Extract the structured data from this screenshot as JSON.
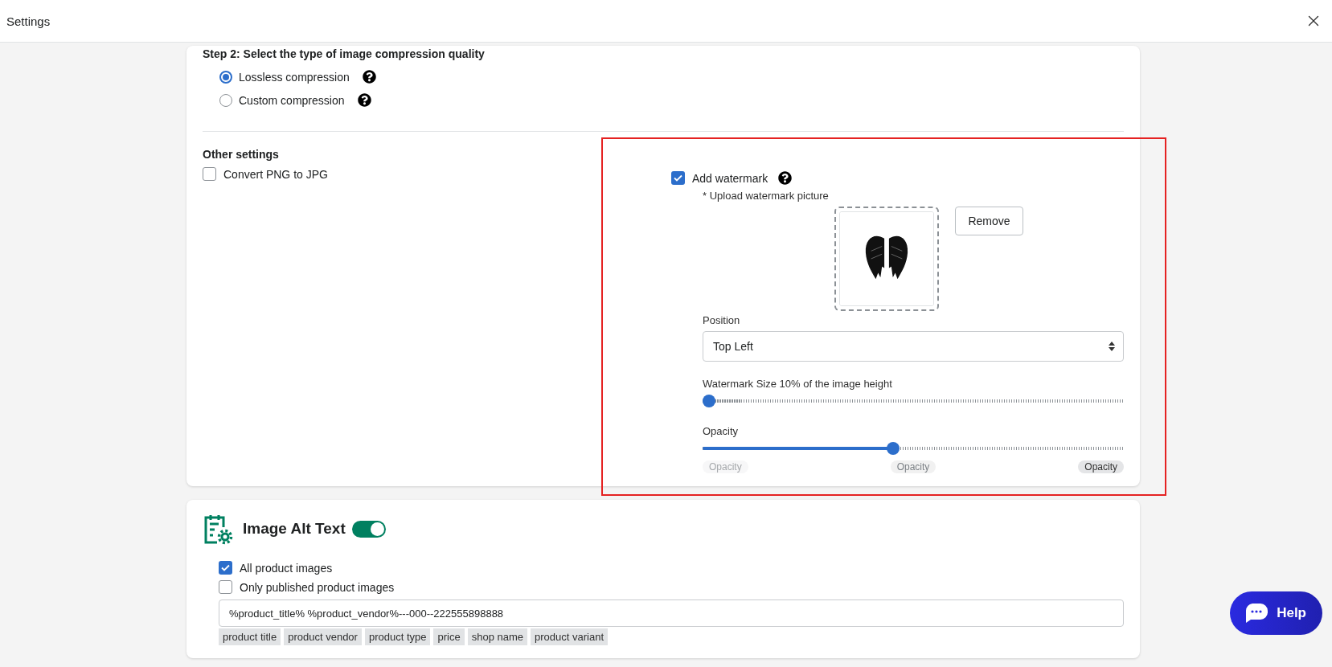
{
  "window": {
    "title": "Settings"
  },
  "compression": {
    "heading": "Step 2: Select the type of image compression quality",
    "options": [
      {
        "label": "Lossless compression",
        "selected": true
      },
      {
        "label": "Custom compression",
        "selected": false
      }
    ]
  },
  "other_settings": {
    "heading": "Other settings",
    "convert_png": {
      "label": "Convert PNG to JPG",
      "checked": false
    },
    "watermark": {
      "label": "Add watermark",
      "checked": true,
      "upload_label": "* Upload watermark picture",
      "remove_button": "Remove",
      "position": {
        "label": "Position",
        "value": "Top Left"
      },
      "size": {
        "label": "Watermark Size 10% of the image height",
        "level": 0
      },
      "opacity": {
        "label": "Opacity",
        "level": 0.45,
        "marks": [
          "Opacity",
          "Opacity",
          "Opacity"
        ]
      }
    }
  },
  "alt_text": {
    "title": "Image Alt Text",
    "on": true,
    "options": [
      {
        "label": "All product images",
        "checked": true
      },
      {
        "label": "Only published product images",
        "checked": false
      }
    ],
    "template": "%product_title% %product_vendor%---000--222555898888",
    "tags": [
      "product title",
      "product vendor",
      "product type",
      "price",
      "shop name",
      "product variant"
    ]
  },
  "help_button": "Help"
}
